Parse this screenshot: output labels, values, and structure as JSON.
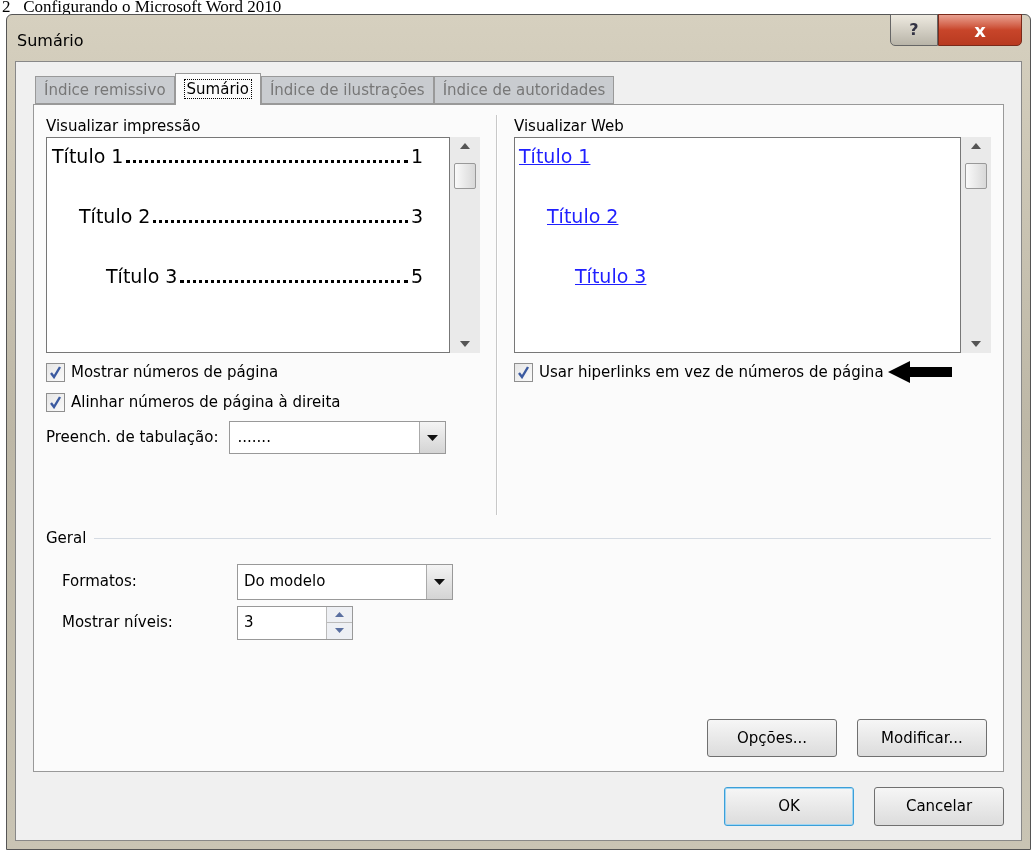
{
  "document_header": "2   Configurando o Microsoft Word 2010",
  "window": {
    "title": "Sumário",
    "help_button": "?",
    "close_button": "x"
  },
  "tabs": [
    {
      "label": "Índice remissivo",
      "selected": false
    },
    {
      "label": "Sumário",
      "selected": true
    },
    {
      "label": "Índice de ilustrações",
      "selected": false
    },
    {
      "label": "Índice de autoridades",
      "selected": false
    }
  ],
  "print_preview": {
    "label": "Visualizar impressão",
    "entries": [
      {
        "text": "Título 1",
        "page": "1",
        "children": [
          {
            "text": "Título 2",
            "page": "3",
            "children": [
              {
                "text": "Título 3",
                "page": "5"
              }
            ]
          }
        ]
      }
    ]
  },
  "print_options": [
    {
      "label": "Mostrar números de página",
      "checked": true
    },
    {
      "label": "Alinhar números de página à direita",
      "checked": true
    }
  ],
  "tab_leader": {
    "label": "Preench. de tabulação:",
    "value": "......."
  },
  "web_preview": {
    "label": "Visualizar Web",
    "entries": [
      {
        "text": "Título 1",
        "children": [
          {
            "text": "Título 2",
            "children": [
              {
                "text": "Título 3"
              }
            ]
          }
        ]
      }
    ]
  },
  "web_options": [
    {
      "label": "Usar hiperlinks em vez de números de página",
      "checked": true
    }
  ],
  "general": {
    "title": "Geral",
    "formats": {
      "label": "Formatos:",
      "value": "Do modelo"
    },
    "levels": {
      "label": "Mostrar níveis:",
      "value": "3"
    }
  },
  "panel_buttons": [
    {
      "label": "Opções..."
    },
    {
      "label": "Modificar..."
    }
  ],
  "dialog_buttons": [
    {
      "label": "OK",
      "default": true
    },
    {
      "label": "Cancelar",
      "default": false
    }
  ]
}
